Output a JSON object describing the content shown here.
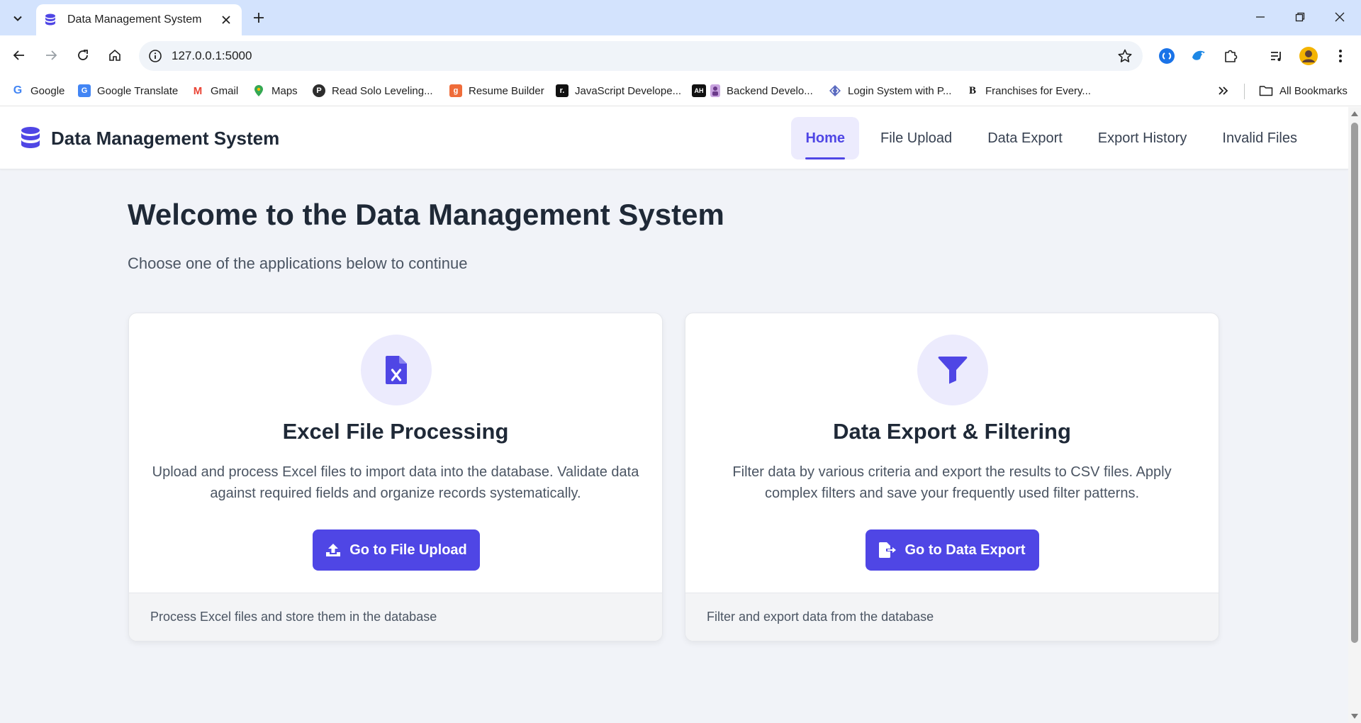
{
  "browser": {
    "tab_title": "Data Management System",
    "url": "127.0.0.1:5000",
    "bookmarks": [
      {
        "label": "Google",
        "icon": "google-icon"
      },
      {
        "label": "Google Translate",
        "icon": "translate-icon"
      },
      {
        "label": "Gmail",
        "icon": "gmail-icon"
      },
      {
        "label": "Maps",
        "icon": "maps-icon"
      },
      {
        "label": "Read Solo Leveling...",
        "icon": "p-icon"
      },
      {
        "label": "Resume Builder",
        "icon": "g-icon"
      },
      {
        "label": "JavaScript Develope...",
        "icon": "r-icon"
      },
      {
        "label": "Backend Develo...",
        "icon": "ah-icon"
      },
      {
        "label": "Login System with P...",
        "icon": "code-icon"
      },
      {
        "label": "Franchises for Every...",
        "icon": "b-icon"
      }
    ],
    "all_bookmarks": "All Bookmarks"
  },
  "app": {
    "brand": "Data Management System",
    "nav": [
      {
        "label": "Home",
        "active": true
      },
      {
        "label": "File Upload",
        "active": false
      },
      {
        "label": "Data Export",
        "active": false
      },
      {
        "label": "Export History",
        "active": false
      },
      {
        "label": "Invalid Files",
        "active": false
      }
    ]
  },
  "main": {
    "title": "Welcome to the Data Management System",
    "subtitle": "Choose one of the applications below to continue",
    "cards": [
      {
        "icon": "excel-file-icon",
        "title": "Excel File Processing",
        "description": "Upload and process Excel files to import data into the database. Validate data against required fields and organize records systematically.",
        "button": "Go to File Upload",
        "footer": "Process Excel files and store them in the database"
      },
      {
        "icon": "funnel-icon",
        "title": "Data Export & Filtering",
        "description": "Filter data by various criteria and export the results to CSV files. Apply complex filters and save your frequently used filter patterns.",
        "button": "Go to Data Export",
        "footer": "Filter and export data from the database"
      }
    ]
  },
  "colors": {
    "accent": "#4f46e5",
    "accent_soft": "#ecebfd",
    "page_bg": "#f1f3f8",
    "tabstrip_bg": "#d3e3fd"
  }
}
